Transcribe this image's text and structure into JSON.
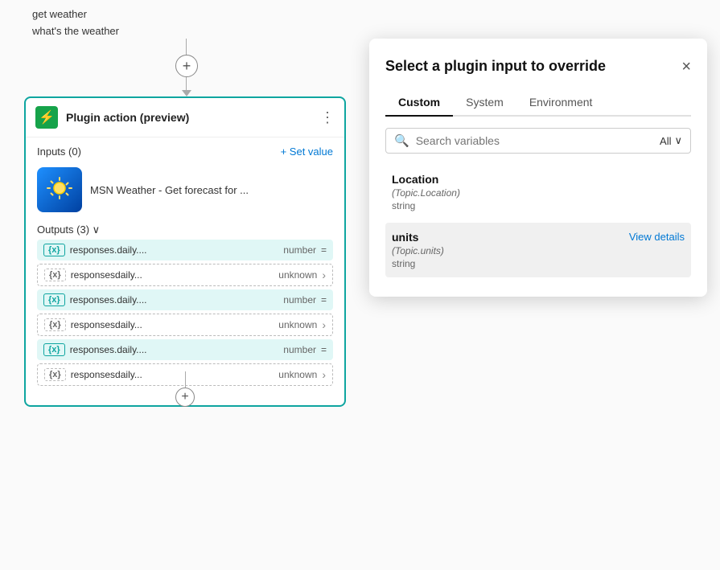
{
  "canvas": {
    "trigger_lines": [
      "get weather",
      "what's the weather"
    ]
  },
  "plugin_card": {
    "title": "Plugin action (preview)",
    "inputs_label": "Inputs (0)",
    "set_value_label": "+ Set value",
    "msn_text": "MSN Weather - Get forecast for ...",
    "outputs_label": "Outputs (3)",
    "outputs": [
      {
        "type": "solid",
        "badge": "{x}",
        "name": "responses.daily....",
        "dtype": "number",
        "extra": "="
      },
      {
        "type": "dashed",
        "badge": "{x}",
        "name": "responsesdaily...",
        "dtype": "unknown"
      },
      {
        "type": "solid",
        "badge": "{x}",
        "name": "responses.daily....",
        "dtype": "number",
        "extra": "="
      },
      {
        "type": "dashed",
        "badge": "{x}",
        "name": "responsesdaily...",
        "dtype": "unknown"
      },
      {
        "type": "solid",
        "badge": "{x}",
        "name": "responses.daily....",
        "dtype": "number",
        "extra": "="
      },
      {
        "type": "dashed",
        "badge": "{x}",
        "name": "responsesdaily...",
        "dtype": "unknown"
      }
    ]
  },
  "panel": {
    "title": "Select a plugin input to override",
    "close_icon": "×",
    "tabs": [
      {
        "label": "Custom",
        "active": true
      },
      {
        "label": "System",
        "active": false
      },
      {
        "label": "Environment",
        "active": false
      }
    ],
    "search_placeholder": "Search variables",
    "filter_label": "All",
    "variables": [
      {
        "name": "Location",
        "path": "(Topic.Location)",
        "type": "string",
        "selected": false,
        "view_details": false
      },
      {
        "name": "units",
        "path": "(Topic.units)",
        "type": "string",
        "selected": true,
        "view_details": true,
        "view_details_label": "View details"
      }
    ]
  }
}
